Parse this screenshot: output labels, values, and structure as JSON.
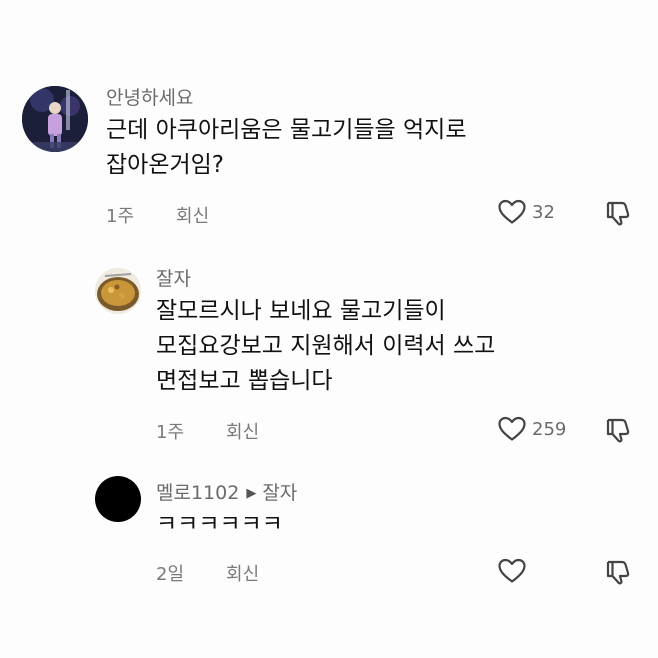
{
  "comments": [
    {
      "username": "안녕하세요",
      "lines": [
        "근데 아쿠아리움은 물고기들을 억지로",
        "잡아온거임?"
      ],
      "time": "1주",
      "reply_label": "회신",
      "likes": "32"
    },
    {
      "username": "잘자",
      "lines": [
        "잘모르시나 보네요 물고기들이",
        "모집요강보고 지원해서 이력서 쓰고",
        "면접보고 뽑습니다"
      ],
      "time": "1주",
      "reply_label": "회신",
      "likes": "259"
    },
    {
      "username": "멜로1102",
      "reply_to": "잘자",
      "lines": [
        "ㅋㅋㅋㅋㅋㅋ"
      ],
      "time": "2일",
      "reply_label": "회신",
      "likes": ""
    }
  ],
  "icons": {
    "like": "heart-outline-icon",
    "dislike": "thumbs-down-outline-icon",
    "reply_arrow": "play-triangle-icon"
  },
  "colors": {
    "background": "#fdfdfd",
    "text": "#111111",
    "muted": "#7a7a7a",
    "avatar_dark": "#000000"
  }
}
